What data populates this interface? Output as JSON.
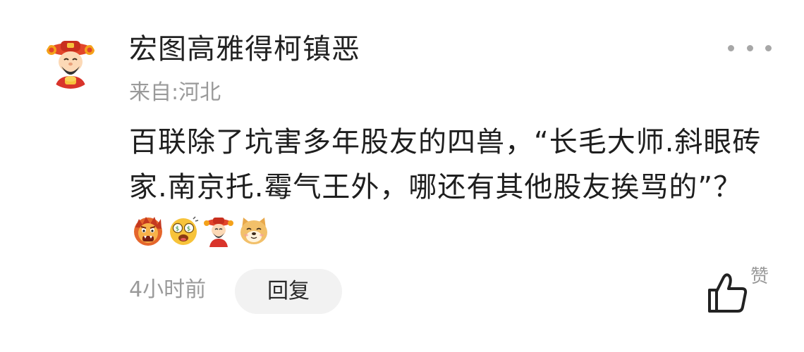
{
  "comment": {
    "username": "宏图高雅得柯镇恶",
    "location": "来自:河北",
    "text": "百联除了坑害多年股友的四兽，“长毛大师.斜眼砖家.南京托.霉气王外，哪还有其他股友挨骂的”？",
    "emojis": [
      "angry-lion-emoji",
      "money-eyes-emoji",
      "fortune-god-emoji",
      "doge-emoji"
    ],
    "time": "4小时前",
    "reply_label": "回复",
    "like_label": "赞",
    "avatar": "fortune-god-avatar",
    "more_icon": "more-dots-icon",
    "like_icon": "thumbs-up-icon"
  },
  "colors": {
    "username": "#222222",
    "secondary": "#9a9a9a",
    "text": "#1e1e1e",
    "reply_bg": "#f2f2f2"
  }
}
